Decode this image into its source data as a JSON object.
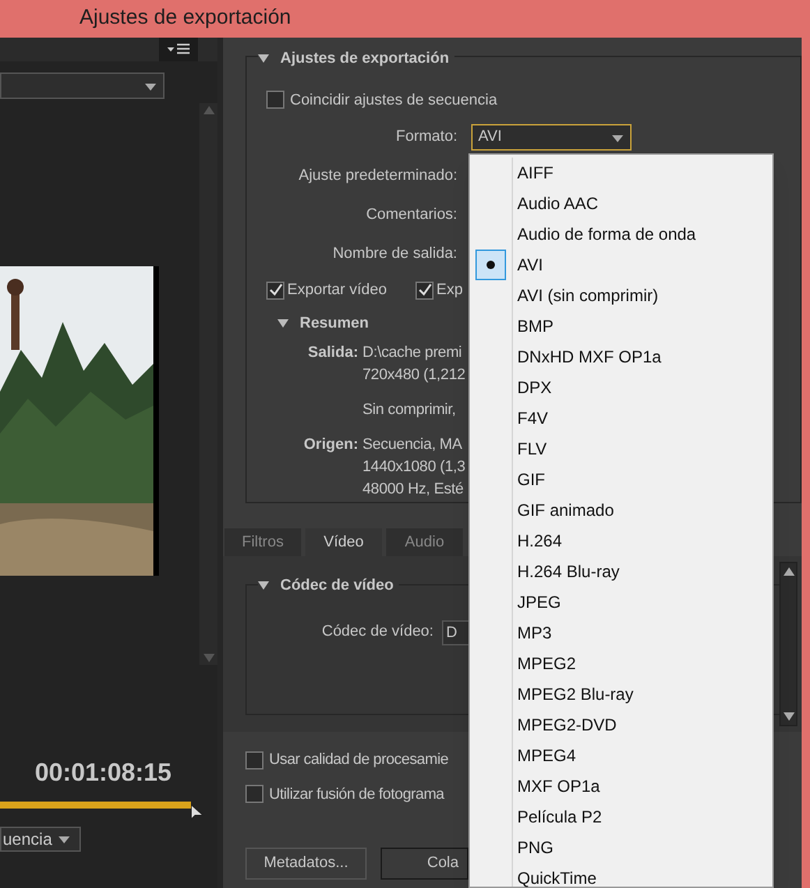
{
  "window": {
    "title": "Ajustes de exportación"
  },
  "source_panel": {
    "timecode": "00:01:08:15",
    "sequence_dropdown": "uencia"
  },
  "export_settings": {
    "heading": "Ajustes de exportación",
    "match_sequence": {
      "label": "Coincidir ajustes de secuencia",
      "checked": false
    },
    "fields": [
      {
        "label": "Formato:",
        "value": "AVI"
      },
      {
        "label": "Ajuste predeterminado:"
      },
      {
        "label": "Comentarios:"
      },
      {
        "label": "Nombre de salida:"
      }
    ],
    "export_checks": [
      {
        "label": "Exportar vídeo",
        "checked": true
      },
      {
        "label": "Exp",
        "checked": true
      }
    ],
    "summary": {
      "heading": "Resumen",
      "rows": [
        {
          "label": "Salida:",
          "lines": [
            "D:\\cache premi",
            "720x480 (1,212"
          ]
        },
        {
          "lines": [
            "Sin comprimir,"
          ]
        },
        {
          "label": "Origen:",
          "lines": [
            "Secuencia, MA",
            "1440x1080 (1,3",
            "48000 Hz, Esté"
          ]
        }
      ]
    }
  },
  "tabs": [
    {
      "label": "Filtros",
      "selected": false
    },
    {
      "label": "Vídeo",
      "selected": true
    },
    {
      "label": "Audio",
      "selected": false
    }
  ],
  "codec_section": {
    "heading": "Códec de vídeo",
    "field_label": "Códec de vídeo:",
    "field_value": "D"
  },
  "options": [
    {
      "label": "Usar calidad de procesamie",
      "checked": false
    },
    {
      "label": "Utilizar fusión de fotograma",
      "checked": false
    }
  ],
  "buttons": [
    "Metadatos...",
    "Cola"
  ],
  "format_menu": [
    {
      "label": "AIFF",
      "selected": false
    },
    {
      "label": "Audio AAC",
      "selected": false
    },
    {
      "label": "Audio de forma de onda",
      "selected": false
    },
    {
      "label": "AVI",
      "selected": true
    },
    {
      "label": "AVI (sin comprimir)",
      "selected": false
    },
    {
      "label": "BMP",
      "selected": false
    },
    {
      "label": "DNxHD MXF OP1a",
      "selected": false
    },
    {
      "label": "DPX",
      "selected": false
    },
    {
      "label": "F4V",
      "selected": false
    },
    {
      "label": "FLV",
      "selected": false
    },
    {
      "label": "GIF",
      "selected": false
    },
    {
      "label": "GIF animado",
      "selected": false
    },
    {
      "label": "H.264",
      "selected": false
    },
    {
      "label": "H.264 Blu-ray",
      "selected": false
    },
    {
      "label": "JPEG",
      "selected": false
    },
    {
      "label": "MP3",
      "selected": false
    },
    {
      "label": "MPEG2",
      "selected": false
    },
    {
      "label": "MPEG2 Blu-ray",
      "selected": false
    },
    {
      "label": "MPEG2-DVD",
      "selected": false
    },
    {
      "label": "MPEG4",
      "selected": false
    },
    {
      "label": "MXF OP1a",
      "selected": false
    },
    {
      "label": "Película P2",
      "selected": false
    },
    {
      "label": "PNG",
      "selected": false
    },
    {
      "label": "QuickTime",
      "selected": false
    }
  ]
}
